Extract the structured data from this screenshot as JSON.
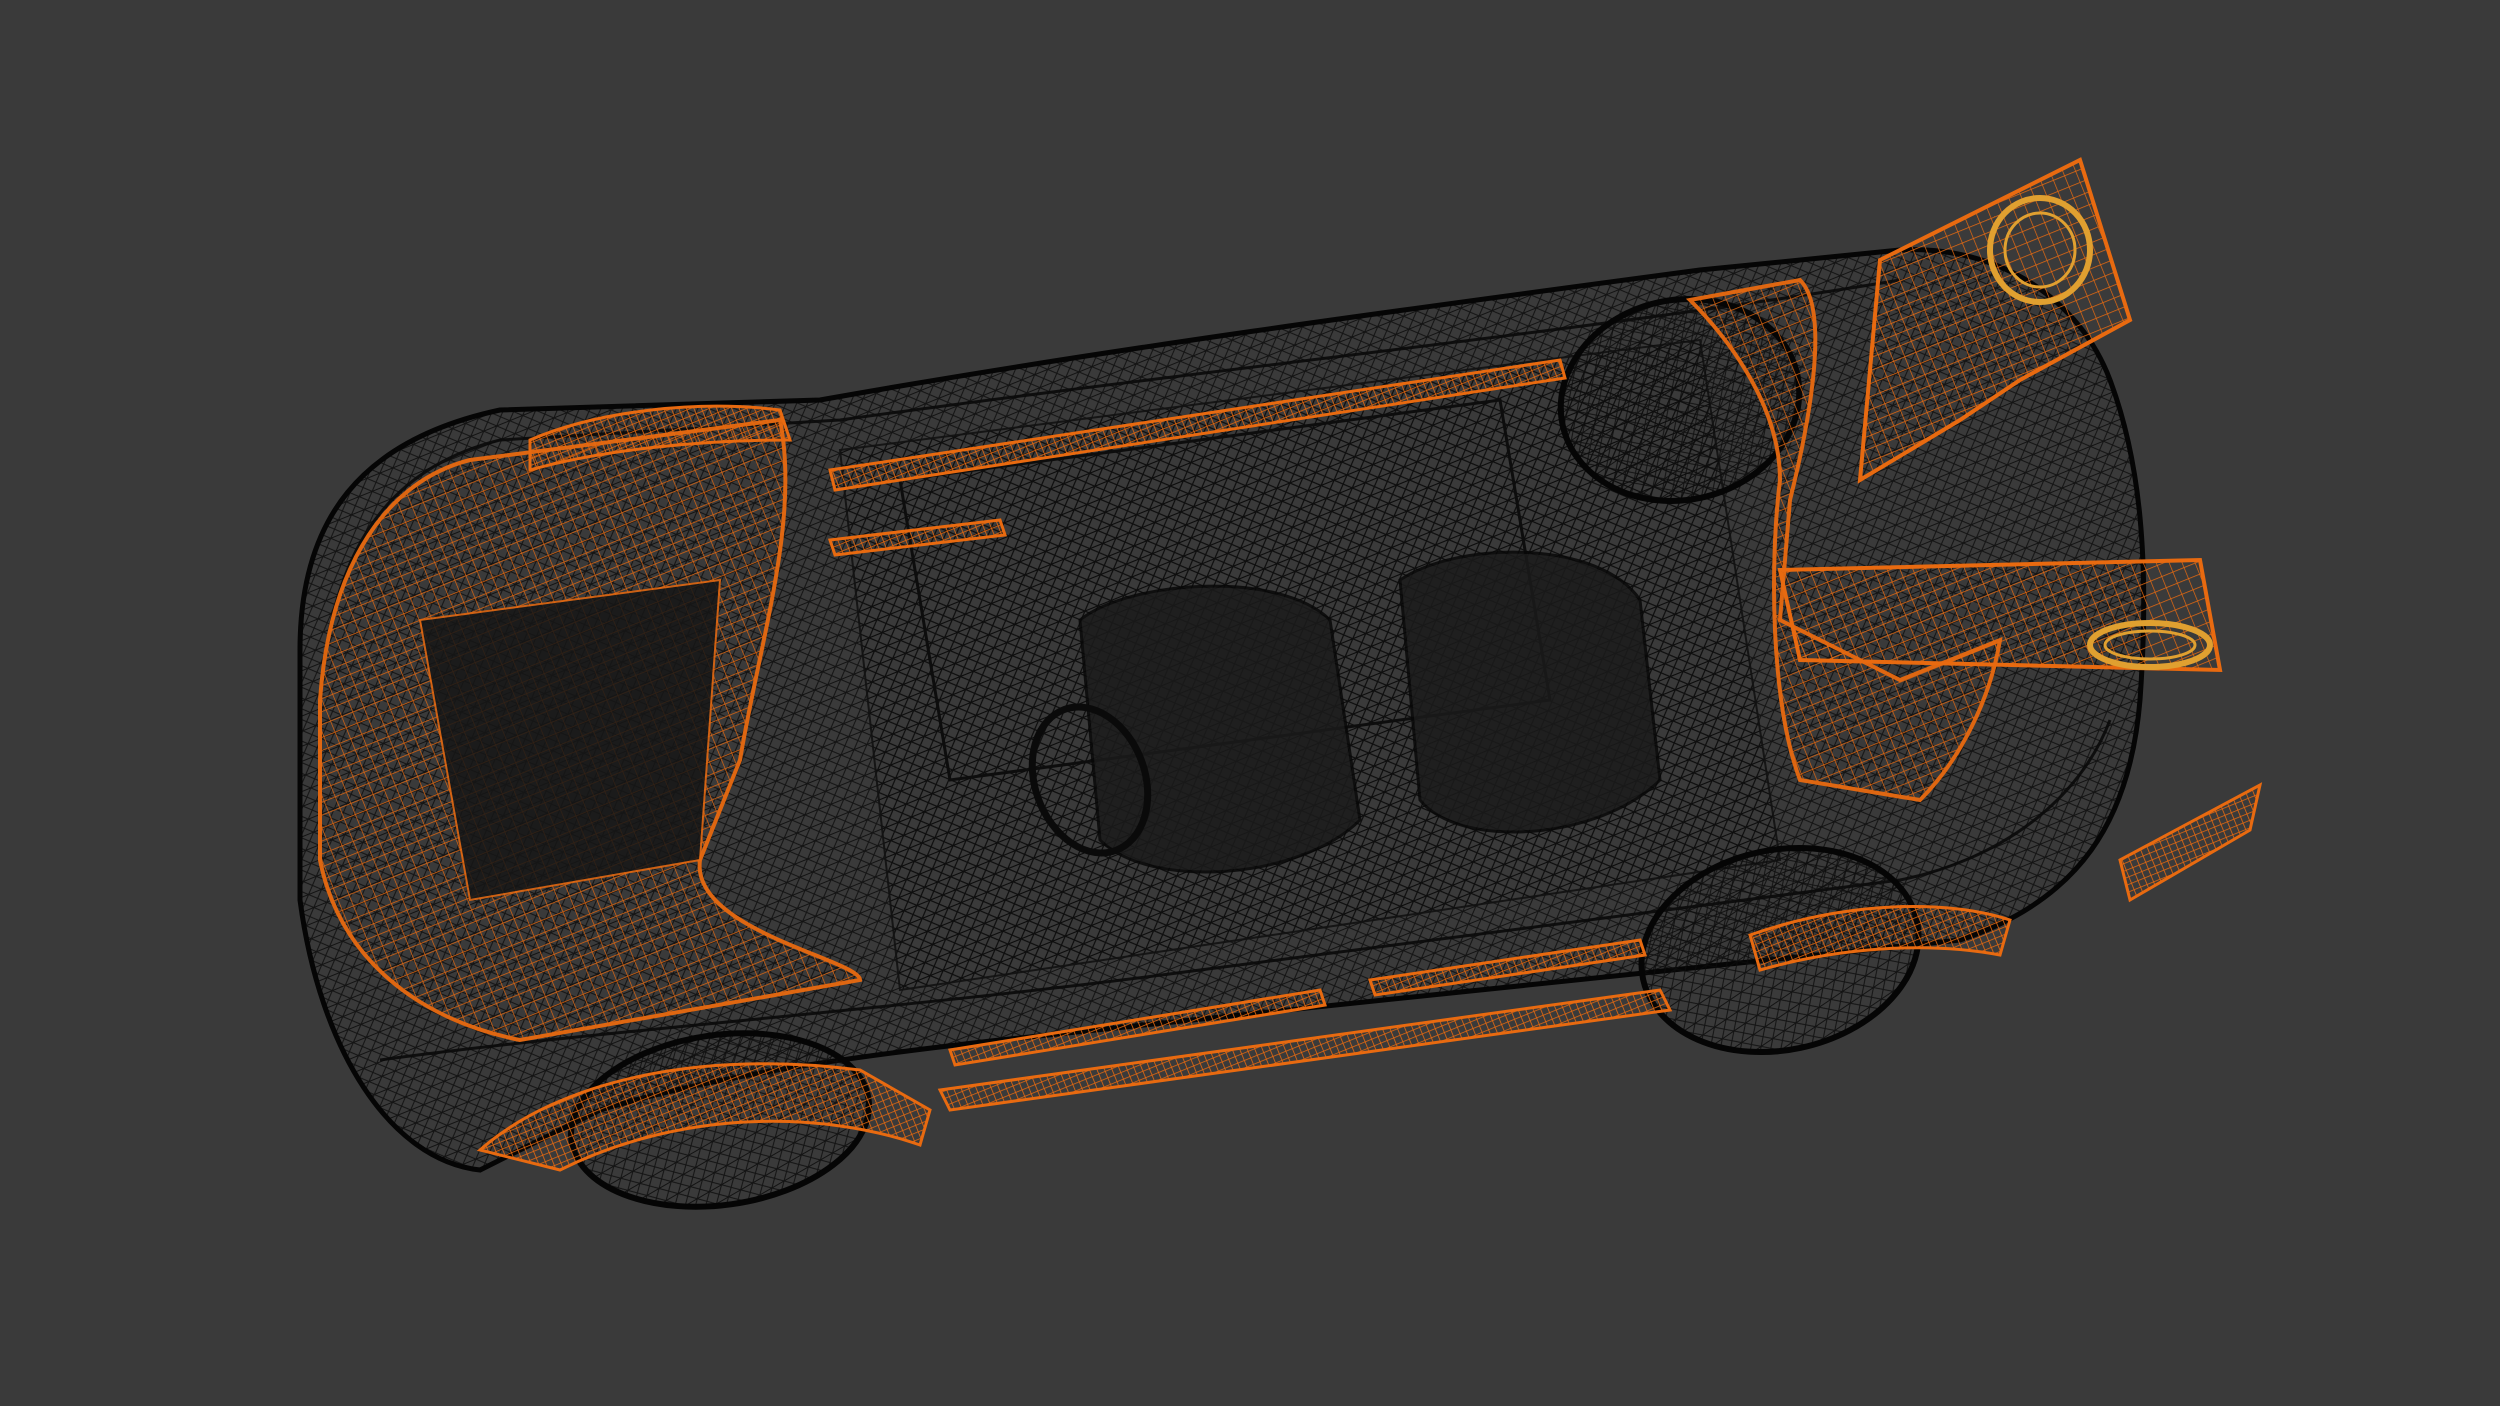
{
  "viewport": {
    "background_color": "#3a3a3a",
    "view_mode": "wireframe",
    "model": "car",
    "selected_parts_color": "#e86a10",
    "unselected_mesh_color": "#0a0a0a"
  },
  "parts": {
    "selected": [
      "hood",
      "front-fender",
      "left-side-skirt",
      "left-door-strip",
      "right-side-skirt",
      "front-wheel-arch",
      "rear-wheel-arch",
      "rear-spoiler-upper",
      "rear-spoiler-lower",
      "rear-diffuser",
      "exhaust-tip-upper",
      "exhaust-tip-lower"
    ],
    "unselected": [
      "body-shell",
      "interior",
      "front-left-wheel",
      "rear-left-wheel",
      "rear-right-wheel",
      "seats",
      "steering-wheel"
    ]
  }
}
